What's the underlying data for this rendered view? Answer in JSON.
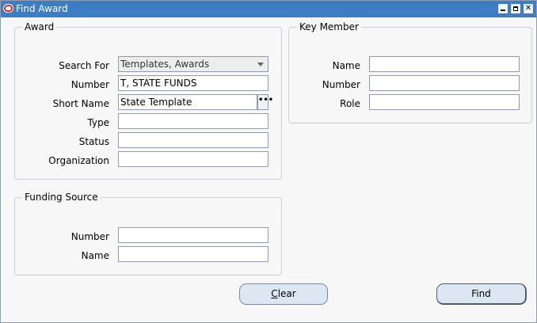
{
  "window": {
    "title": "Find Award"
  },
  "award": {
    "legend": "Award",
    "search_for_label": "Search For",
    "search_for_value": "Templates, Awards",
    "number_label": "Number",
    "number_value": "T, STATE FUNDS",
    "short_name_label": "Short Name",
    "short_name_value": "State Template",
    "type_label": "Type",
    "type_value": "",
    "status_label": "Status",
    "status_value": "",
    "organization_label": "Organization",
    "organization_value": ""
  },
  "key_member": {
    "legend": "Key Member",
    "name_label": "Name",
    "name_value": "",
    "number_label": "Number",
    "number_value": "",
    "role_label": "Role",
    "role_value": ""
  },
  "funding_source": {
    "legend": "Funding Source",
    "number_label": "Number",
    "number_value": "",
    "name_label": "Name",
    "name_value": ""
  },
  "buttons": {
    "clear_first": "C",
    "clear_rest": "lear",
    "find": "Find"
  }
}
